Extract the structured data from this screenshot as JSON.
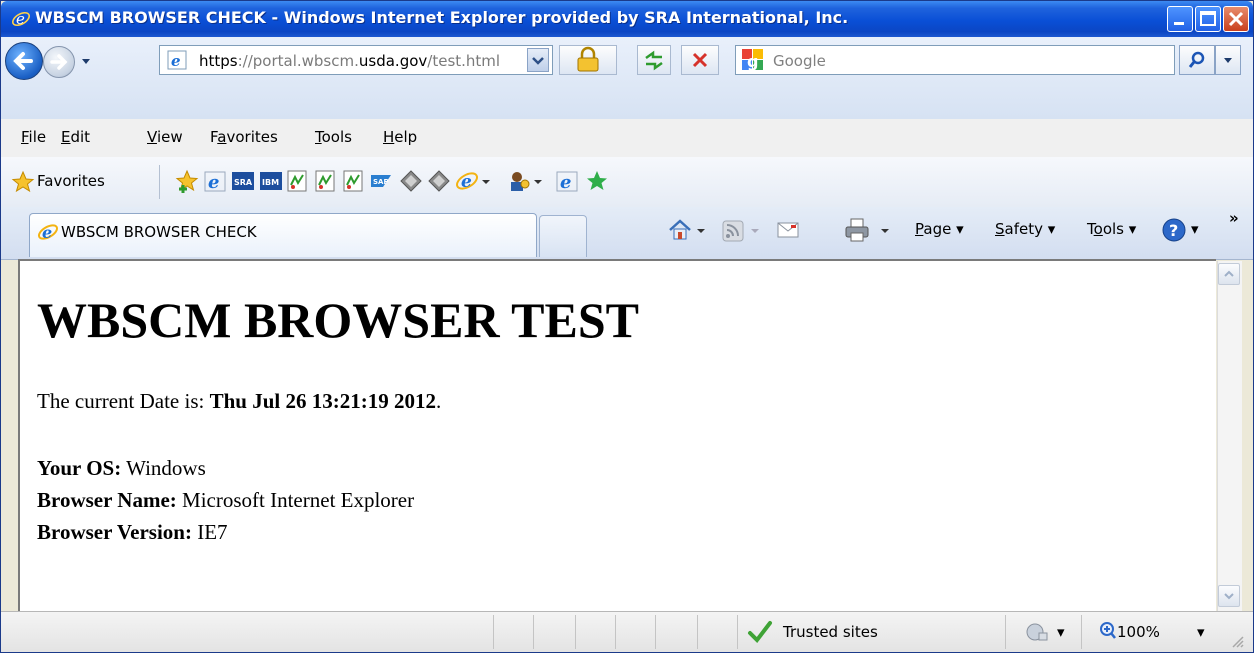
{
  "window": {
    "title": "WBSCM BROWSER CHECK - Windows Internet Explorer provided by SRA International, Inc."
  },
  "address_bar": {
    "url_prefix": "https",
    "url_mid1": "://portal.wbscm.",
    "url_host": "usda.gov",
    "url_path": "/test.html"
  },
  "search": {
    "placeholder": "Google"
  },
  "menu": {
    "items": [
      {
        "key": "F",
        "rest": "ile"
      },
      {
        "key": "E",
        "rest": "dit"
      },
      {
        "key": "V",
        "rest": "iew"
      },
      {
        "pre": "F",
        "key": "a",
        "rest": "vorites"
      },
      {
        "key": "T",
        "rest": "ools"
      },
      {
        "key": "H",
        "rest": "elp"
      }
    ]
  },
  "favorites": {
    "label": "Favorites"
  },
  "tab": {
    "label": "WBSCM BROWSER CHECK"
  },
  "command_bar": {
    "page_label": "Page",
    "safety_label": "Safety",
    "tools_label": "Tools"
  },
  "page": {
    "heading": "WBSCM BROWSER TEST",
    "date_prefix": "The current Date is: ",
    "date_value": "Thu Jul 26 13:21:19 2012",
    "date_suffix": ".",
    "os_label": "Your OS:",
    "os_value": " Windows",
    "browser_name_label": "Browser Name:",
    "browser_name_value": " Microsoft Internet Explorer",
    "browser_version_label": "Browser Version:",
    "browser_version_value": " IE7"
  },
  "status_bar": {
    "zone_label": "Trusted sites",
    "zoom_label": "100%"
  },
  "colors": {
    "titlebar": "#0a4fd6",
    "close_button": "#c9401d",
    "trusted_check": "#3fa336"
  },
  "icons": [
    "ie-logo-icon",
    "back-arrow-icon",
    "forward-arrow-icon",
    "lock-icon",
    "refresh-icon",
    "stop-icon",
    "google-icon",
    "search-icon",
    "star-icon",
    "add-favorite-icon",
    "home-icon",
    "feeds-icon",
    "mail-icon",
    "print-icon",
    "help-icon",
    "check-icon",
    "security-zone-icon",
    "zoom-icon"
  ]
}
